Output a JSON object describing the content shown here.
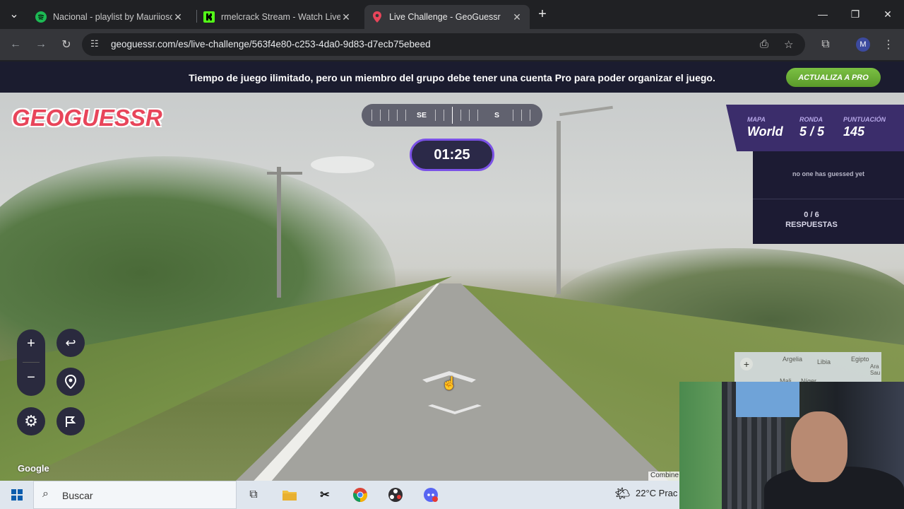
{
  "tabs": [
    {
      "title": "Nacional - playlist by Mauriiosc",
      "icon": "spotify-icon",
      "color": "#1db954"
    },
    {
      "title": "rmelcrack Stream - Watch Live c",
      "icon": "kick-icon",
      "color": "#53fc18"
    },
    {
      "title": "Live Challenge - GeoGuessr",
      "icon": "geoguessr-pin-icon",
      "color": "#e8455a"
    }
  ],
  "address": {
    "url": "geoguessr.com/es/live-challenge/563f4e80-c253-4da0-9d83-d7ecb75ebeed"
  },
  "profile": {
    "initial": "M"
  },
  "banner": {
    "message": "Tiempo de juego ilimitado, pero un miembro del grupo debe tener una cuenta Pro para poder organizar el juego.",
    "cta": "ACTUALIZA A PRO"
  },
  "game": {
    "logo": "GEOGUESSR",
    "compass": {
      "labels": [
        "SE",
        "S"
      ]
    },
    "timer": "01:25",
    "hud": {
      "map_label": "MAPA",
      "map_value": "World",
      "round_label": "RONDA",
      "round_value": "5 / 5",
      "score_label": "PUNTUACIÓN",
      "score_value": "145"
    },
    "guesses": {
      "empty_msg": "no one has guessed yet",
      "count": "0 / 6",
      "count_label": "RESPUESTAS"
    },
    "minimap": {
      "labels": [
        "Argelia",
        "Libia",
        "Egipto",
        "Ara Sau",
        "Mali",
        "Níger"
      ]
    },
    "attribution": "Google",
    "attribution_right": "Combine"
  },
  "taskbar": {
    "search_placeholder": "Buscar",
    "weather": "22°C  Prac"
  },
  "colors": {
    "accent": "#7b52e6",
    "banner_bg": "#1b1c2f",
    "pro_button": "#6fb13a",
    "logo": "#e8455a"
  }
}
